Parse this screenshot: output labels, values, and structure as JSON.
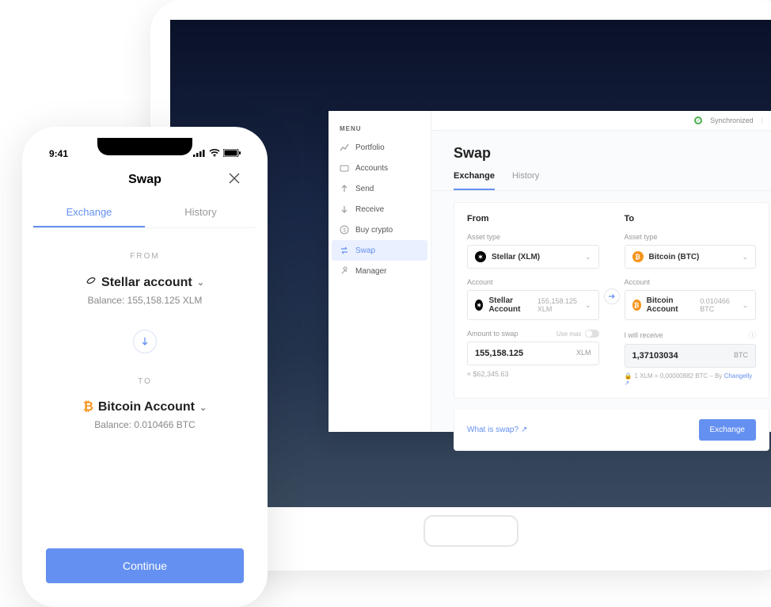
{
  "phone": {
    "time": "9:41",
    "title": "Swap",
    "tabs": {
      "exchange": "Exchange",
      "history": "History"
    },
    "from_label": "FROM",
    "from_account": "Stellar account",
    "from_balance": "Balance: 155,158.125 XLM",
    "to_label": "TO",
    "to_account": "Bitcoin Account",
    "to_balance": "Balance: 0.010466 BTC",
    "continue": "Continue"
  },
  "desktop": {
    "menu_title": "MENU",
    "nav": {
      "portfolio": "Portfolio",
      "accounts": "Accounts",
      "send": "Send",
      "receive": "Receive",
      "buy": "Buy crypto",
      "swap": "Swap",
      "manager": "Manager"
    },
    "sync": "Synchronized",
    "page_title": "Swap",
    "tabs": {
      "exchange": "Exchange",
      "history": "History"
    },
    "from": {
      "heading": "From",
      "asset_label": "Asset type",
      "asset_value": "Stellar (XLM)",
      "account_label": "Account",
      "account_value": "Stellar Account",
      "account_balance": "155,158.125 XLM",
      "amount_label": "Amount to swap",
      "use_max": "Use max",
      "amount_value": "155,158.125",
      "amount_unit": "XLM",
      "usd_equiv": "≈ $62,345.63"
    },
    "to": {
      "heading": "To",
      "asset_label": "Asset type",
      "asset_value": "Bitcoin (BTC)",
      "account_label": "Account",
      "account_value": "Bitcoin Account",
      "account_balance": "0.010466 BTC",
      "receive_label": "I will receive",
      "receive_value": "1,37103034",
      "receive_unit": "BTC",
      "rate_prefix": "1 XLM = 0,00000882 BTC   –  By ",
      "rate_provider": "Changelly"
    },
    "what_is": "What is swap?",
    "exchange_btn": "Exchange"
  }
}
